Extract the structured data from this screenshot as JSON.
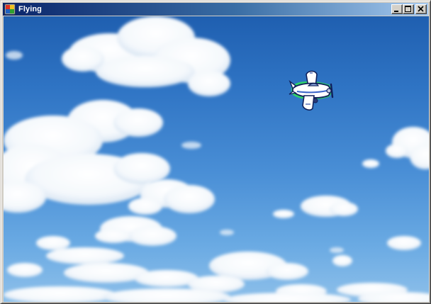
{
  "window": {
    "title": "Flying",
    "title_color": "#ffffff",
    "titlebar_gradient": [
      "#0a246a",
      "#3a6ea5",
      "#a6caf0"
    ],
    "chrome_color": "#d4d0c8",
    "caption_buttons": [
      "minimize-icon",
      "maximize-icon",
      "close-icon"
    ]
  },
  "scene": {
    "background": "sky-with-clouds",
    "sky_colors": [
      "#1f5fb0",
      "#4a8fd6",
      "#8ec0ea"
    ],
    "sprite": "airplane-icon"
  }
}
